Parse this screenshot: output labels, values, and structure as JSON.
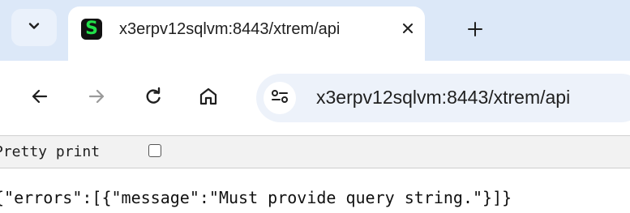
{
  "tab": {
    "search_icon": "chevron-down-icon",
    "favicon_letter": "S",
    "title": "x3erpv12sqlvm:8443/xtrem/api",
    "close_icon": "close-icon",
    "new_tab_icon": "plus-icon"
  },
  "toolbar": {
    "back_icon": "arrow-left-icon",
    "forward_icon": "arrow-right-icon",
    "reload_icon": "reload-icon",
    "home_icon": "home-icon",
    "site_info_icon": "tune-icon",
    "url": "x3erpv12sqlvm:8443/xtrem/api"
  },
  "viewer": {
    "pretty_print_label": "Pretty print",
    "pretty_print_checked": false,
    "body": "{\"errors\":[{\"message\":\"Must provide query string.\"}]}"
  },
  "colors": {
    "tabstrip_bg": "#dce8f8",
    "omnibox_bg": "#edf2fa",
    "favicon_bg": "#111111",
    "favicon_fg": "#22e04a"
  }
}
